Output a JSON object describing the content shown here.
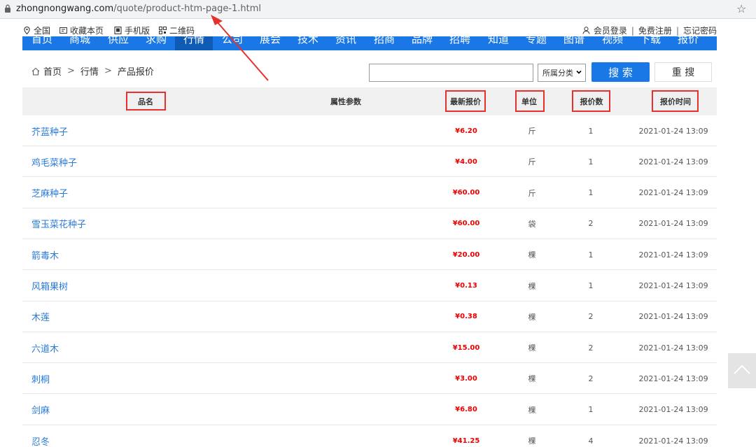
{
  "address_bar": {
    "host": "zhongnongwang.com",
    "path": "/quote/product-htm-page-1.html"
  },
  "topbar": {
    "left": [
      {
        "label": "全国",
        "icon": "location-pin-icon"
      },
      {
        "label": "收藏本页",
        "icon": "bookmark-icon"
      },
      {
        "label": "手机版",
        "icon": "mobile-icon"
      },
      {
        "label": "二维码",
        "icon": "qrcode-icon"
      }
    ],
    "right": {
      "login": "会员登录",
      "register": "免费注册",
      "forgot": "忘记密码",
      "sep": "|"
    }
  },
  "nav": {
    "items": [
      "首页",
      "商城",
      "供应",
      "求购",
      "行情",
      "公司",
      "展会",
      "技术",
      "资讯",
      "招商",
      "品牌",
      "招聘",
      "知道",
      "专题",
      "图谱",
      "视频",
      "下载",
      "报价"
    ],
    "active_index": 4
  },
  "breadcrumb": {
    "home": "首页",
    "level1": "行情",
    "level2": "产品报价",
    "sep": ">"
  },
  "search": {
    "input_value": "",
    "category": "所属分类",
    "search_label": "搜 索",
    "reset_label": "重 搜"
  },
  "table": {
    "headers": {
      "name": "品名",
      "attrs": "属性参数",
      "price": "最新报价",
      "unit": "单位",
      "count": "报价数",
      "time": "报价时间"
    },
    "rows": [
      {
        "name": "芥蓝种子",
        "price": "¥6.20",
        "unit": "斤",
        "count": "1",
        "time": "2021-01-24 13:09"
      },
      {
        "name": "鸡毛菜种子",
        "price": "¥4.00",
        "unit": "斤",
        "count": "1",
        "time": "2021-01-24 13:09"
      },
      {
        "name": "芝麻种子",
        "price": "¥60.00",
        "unit": "斤",
        "count": "1",
        "time": "2021-01-24 13:09"
      },
      {
        "name": "雪玉菜花种子",
        "price": "¥60.00",
        "unit": "袋",
        "count": "2",
        "time": "2021-01-24 13:09"
      },
      {
        "name": "箭毒木",
        "price": "¥20.00",
        "unit": "棵",
        "count": "1",
        "time": "2021-01-24 13:09"
      },
      {
        "name": "风箱果树",
        "price": "¥0.13",
        "unit": "棵",
        "count": "1",
        "time": "2021-01-24 13:09"
      },
      {
        "name": "木莲",
        "price": "¥0.38",
        "unit": "棵",
        "count": "2",
        "time": "2021-01-24 13:09"
      },
      {
        "name": "六道木",
        "price": "¥15.00",
        "unit": "棵",
        "count": "2",
        "time": "2021-01-24 13:09"
      },
      {
        "name": "刺桐",
        "price": "¥3.00",
        "unit": "棵",
        "count": "2",
        "time": "2021-01-24 13:09"
      },
      {
        "name": "剑麻",
        "price": "¥6.80",
        "unit": "棵",
        "count": "1",
        "time": "2021-01-24 13:09"
      },
      {
        "name": "忍冬",
        "price": "¥41.25",
        "unit": "棵",
        "count": "4",
        "time": "2021-01-24 13:09"
      }
    ]
  },
  "colors": {
    "accent": "#1a77e6",
    "price": "#ee0000",
    "annotation": "#e6312e",
    "link": "#2a7ad8"
  }
}
